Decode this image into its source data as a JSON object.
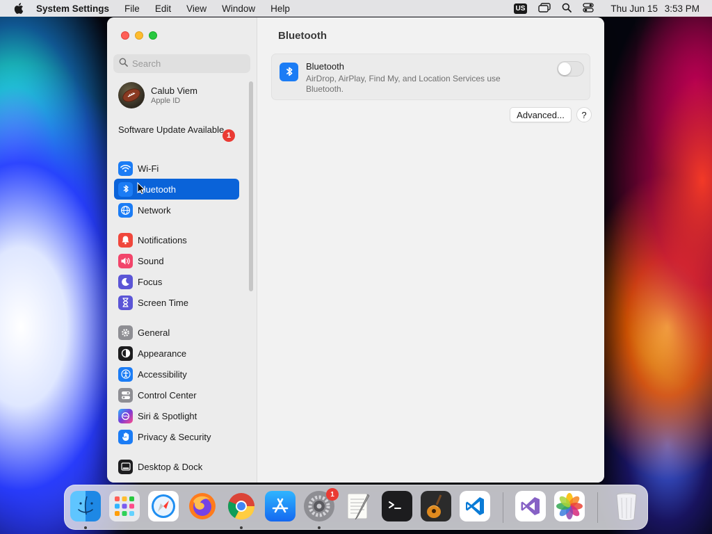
{
  "menubar": {
    "app_name": "System Settings",
    "items": [
      "File",
      "Edit",
      "View",
      "Window",
      "Help"
    ],
    "input_source": "US",
    "day": "Thu Jun 15",
    "time": "3:53 PM"
  },
  "search": {
    "placeholder": "Search"
  },
  "profile": {
    "name": "Calub Viem",
    "subtitle": "Apple ID"
  },
  "software_update": {
    "label": "Software Update Available",
    "badge": "1"
  },
  "sidebar": {
    "items": [
      {
        "label": "Wi-Fi",
        "icon": "wifi-icon",
        "color": "#1b7cf5"
      },
      {
        "label": "Bluetooth",
        "icon": "bluetooth-icon",
        "color": "#1b7cf5",
        "selected": true
      },
      {
        "label": "Network",
        "icon": "globe-icon",
        "color": "#1b7cf5"
      },
      {
        "label": "Notifications",
        "icon": "bell-icon",
        "color": "#f0473c"
      },
      {
        "label": "Sound",
        "icon": "speaker-icon",
        "color": "#f2456a"
      },
      {
        "label": "Focus",
        "icon": "moon-icon",
        "color": "#5b55d6"
      },
      {
        "label": "Screen Time",
        "icon": "hourglass-icon",
        "color": "#5b55d6"
      },
      {
        "label": "General",
        "icon": "gear-icon",
        "color": "#8e8e93"
      },
      {
        "label": "Appearance",
        "icon": "appearance-icon",
        "color": "#1c1c1e"
      },
      {
        "label": "Accessibility",
        "icon": "accessibility-icon",
        "color": "#1b7cf5"
      },
      {
        "label": "Control Center",
        "icon": "control-center-icon",
        "color": "#8e8e93"
      },
      {
        "label": "Siri & Spotlight",
        "icon": "siri-icon",
        "color": "#7a3bd6"
      },
      {
        "label": "Privacy & Security",
        "icon": "hand-icon",
        "color": "#1b7cf5"
      },
      {
        "label": "Desktop & Dock",
        "icon": "dock-icon",
        "color": "#1c1c1e"
      }
    ]
  },
  "main": {
    "title": "Bluetooth",
    "card": {
      "title": "Bluetooth",
      "description": "AirDrop, AirPlay, Find My, and Location Services use Bluetooth.",
      "enabled": false
    },
    "advanced_label": "Advanced...",
    "help_label": "?"
  },
  "dock": {
    "items": [
      {
        "name": "Finder",
        "icon": "finder-icon",
        "running": true
      },
      {
        "name": "Launchpad",
        "icon": "launchpad-icon"
      },
      {
        "name": "Safari",
        "icon": "safari-icon"
      },
      {
        "name": "Firefox",
        "icon": "firefox-icon"
      },
      {
        "name": "Google Chrome",
        "icon": "chrome-icon",
        "running": true
      },
      {
        "name": "App Store",
        "icon": "app-store-icon"
      },
      {
        "name": "System Settings",
        "icon": "system-settings-icon",
        "running": true,
        "badge": "1"
      },
      {
        "name": "TextEdit",
        "icon": "textedit-icon"
      },
      {
        "name": "Terminal",
        "icon": "terminal-icon"
      },
      {
        "name": "GarageBand",
        "icon": "garageband-icon"
      },
      {
        "name": "Visual Studio Code",
        "icon": "vscode-icon"
      },
      {
        "name": "Visual Studio",
        "icon": "visual-studio-icon"
      },
      {
        "name": "Photos",
        "icon": "photos-icon"
      },
      {
        "name": "Trash",
        "icon": "trash-icon"
      }
    ]
  }
}
